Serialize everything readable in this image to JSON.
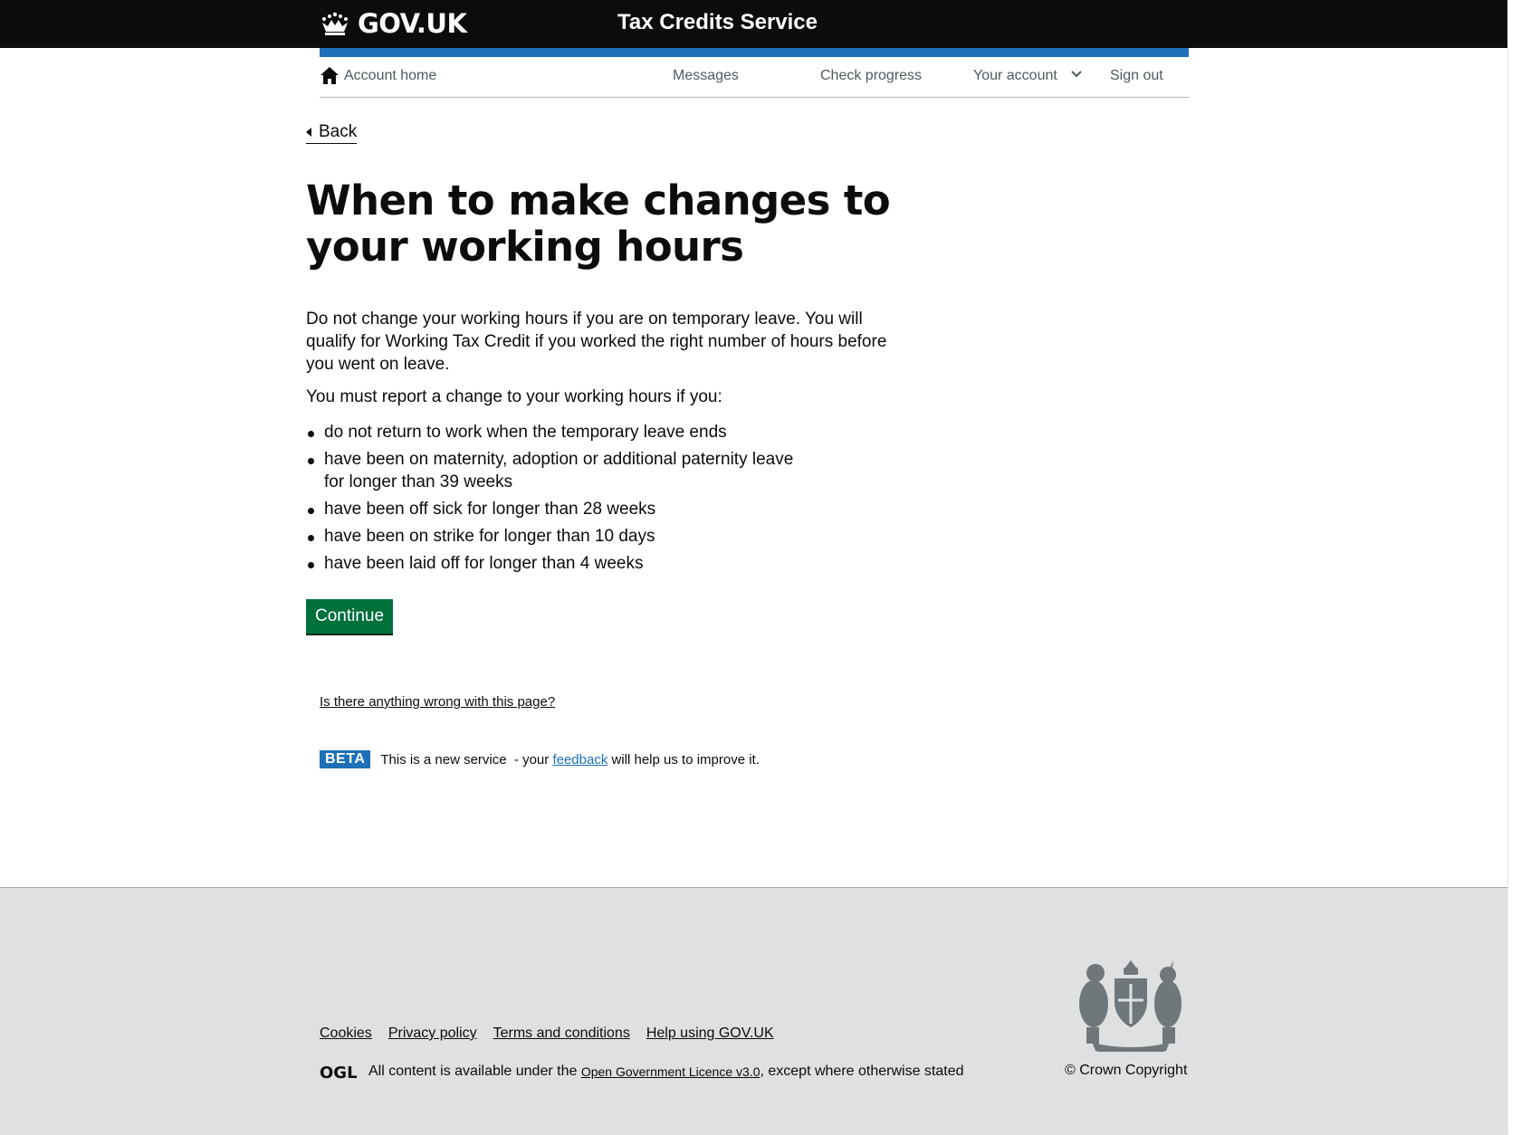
{
  "header": {
    "logo_text": "GOV.UK",
    "service_name": "Tax Credits Service"
  },
  "account_nav": {
    "home": "Account home",
    "messages": "Messages",
    "check_progress": "Check progress",
    "your_account": "Your account",
    "sign_out": "Sign out"
  },
  "back_label": "Back",
  "main": {
    "title": "When to make changes to your working hours",
    "paragraph_1": "Do not change your working hours if you are on temporary leave. You will qualify for Working Tax Credit if you worked the right number of hours before you went on leave.",
    "paragraph_2": "You must report a change to your working hours if you:",
    "bullets": [
      "do not return to work when the temporary leave ends",
      "have been on maternity, adoption or additional paternity leave for longer than 39 weeks",
      "have been off sick for longer than 28 weeks",
      "have been on strike for longer than 10 days",
      "have been laid off for longer than 4 weeks"
    ],
    "continue_label": "Continue"
  },
  "report_link": "Is there anything wrong with this page?",
  "beta": {
    "tag": "BETA",
    "text_before": "This is a new service  - your ",
    "link": "feedback",
    "text_after": " will help us to improve it."
  },
  "footer": {
    "links": [
      "Cookies",
      "Privacy policy",
      "Terms and conditions",
      "Help using GOV.UK"
    ],
    "ogl_label": "OGL",
    "licence_before": "All content is available under the ",
    "licence_link": "Open Government Licence v3.0",
    "licence_after": ", except where otherwise stated",
    "copyright": "© Crown Copyright"
  },
  "colors": {
    "header_bg": "#0b0c0c",
    "brand_blue": "#1d70b8",
    "button_green": "#00703c",
    "footer_bg": "#dee0e2"
  }
}
